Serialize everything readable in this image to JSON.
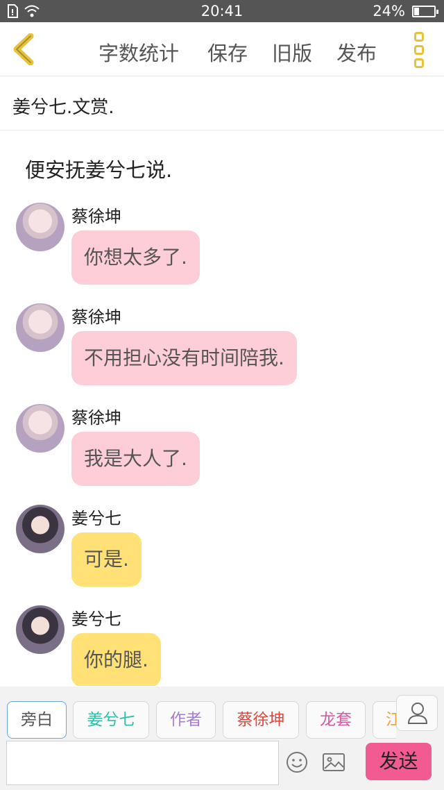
{
  "status_bar": {
    "time": "20:41",
    "battery_percent": "24%",
    "battery_level": 0.24
  },
  "header": {
    "actions": [
      "字数统计",
      "保存",
      "旧版",
      "发布"
    ]
  },
  "chapter_title": "姜兮七.文赏.",
  "narration": "便安抚姜兮七说.",
  "messages": [
    {
      "sender": "蔡徐坤",
      "text": "你想太多了.",
      "bubble_color": "#fdcdd8"
    },
    {
      "sender": "蔡徐坤",
      "text": "不用担心没有时间陪我.",
      "bubble_color": "#fdcdd8"
    },
    {
      "sender": "蔡徐坤",
      "text": "我是大人了.",
      "bubble_color": "#fdcdd8"
    },
    {
      "sender": "姜兮七",
      "text": "可是.",
      "bubble_color": "#ffe175"
    },
    {
      "sender": "姜兮七",
      "text": "你的腿.",
      "bubble_color": "#ffe175"
    }
  ],
  "roles": [
    {
      "label": "旁白",
      "color": "#555555",
      "selected": true
    },
    {
      "label": "姜兮七",
      "color": "#2bbfa8"
    },
    {
      "label": "作者",
      "color": "#a77ad6"
    },
    {
      "label": "蔡徐坤",
      "color": "#e0463c"
    },
    {
      "label": "龙套",
      "color": "#d85aa0"
    },
    {
      "label": "江",
      "color": "#f0a040"
    }
  ],
  "input": {
    "value": "",
    "send_label": "发送"
  },
  "icons": [
    "back-chevron-icon",
    "more-dots-icon",
    "sim-icon",
    "wifi-icon",
    "battery-icon",
    "person-icon",
    "emoji-icon",
    "image-icon"
  ],
  "accent_colors": {
    "back": "#e8c23a",
    "send": "#f25a92",
    "pink_bubble": "#fdcdd8",
    "yellow_bubble": "#ffe175"
  }
}
